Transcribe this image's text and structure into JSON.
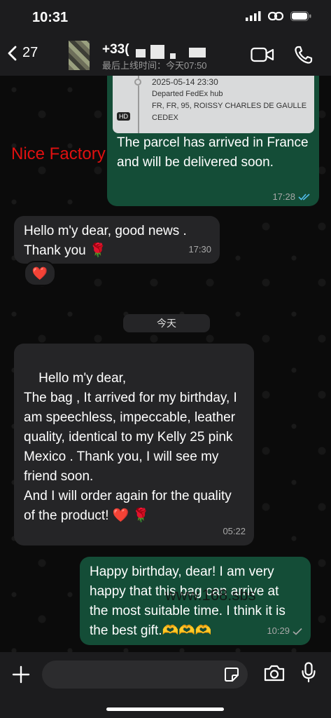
{
  "status_bar": {
    "time": "10:31"
  },
  "header": {
    "back_count": "27",
    "contact_name": "+33(",
    "contact_status": "最后上线时间：今天07:50"
  },
  "chat": {
    "tracking": {
      "date": "2025-05-14 23:30",
      "line1": "Departed FedEx hub",
      "line2": "FR, FR, 95, ROISSY CHARLES DE GAULLE",
      "line3": "CEDEX",
      "hd_label": "HD"
    },
    "watermark_red": "Nice Factory",
    "watermark_url": "www.168.sbs",
    "messages": [
      {
        "dir": "out",
        "text": "The parcel has arrived in France and will be delivered soon.",
        "time": "17:28"
      },
      {
        "dir": "in",
        "text": "Hello m'y dear, good news . Thank you 🌹",
        "time": "17:30",
        "reaction": "❤️"
      },
      {
        "dir": "in",
        "text": "Hello m'y dear,\nThe bag , It arrived for my birthday, I am speechless, impeccable, leather quality, identical to my Kelly 25 pink Mexico . Thank you, I will see my friend soon.\nAnd I will order again for the quality of the product! ❤️ 🌹",
        "time": "05:22"
      },
      {
        "dir": "out",
        "text": "Happy birthday, dear! I am very happy that this bag can arrive at the most suitable time. I think it is the best gift.🫶🫶🫶",
        "time": "10:29"
      }
    ],
    "date_separator": "今天"
  },
  "colors": {
    "outgoing": "#144d37",
    "incoming": "#252527",
    "read_ticks": "#53bdeb"
  },
  "icons": [
    "back-chevron-icon",
    "video-call-icon",
    "phone-call-icon",
    "plus-icon",
    "sticker-icon",
    "camera-icon",
    "microphone-icon"
  ]
}
